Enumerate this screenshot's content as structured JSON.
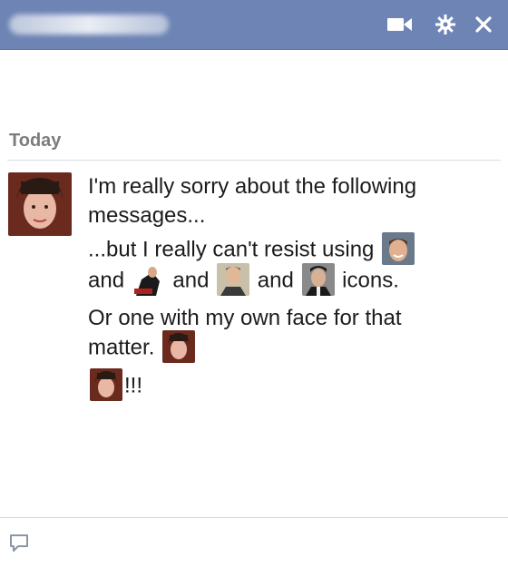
{
  "window": {
    "title_blurred": "",
    "icons": [
      "video-call-icon",
      "gear-icon",
      "close-icon"
    ]
  },
  "conversation": {
    "date_label": "Today",
    "messages": {
      "line1": "I'm really sorry about the following messages...",
      "line2_text": "...but I really can't resist using",
      "line3_and_1": "and",
      "line3_and_2": "and",
      "line3_and_3": "and",
      "line3_end": "icons.",
      "line4": "Or one with my own face for that",
      "line5": "matter.",
      "line6": "!!!"
    }
  },
  "footer": {
    "icon": "compose-icon"
  },
  "colors": {
    "titlebar": "#6d84b4",
    "date_text": "#7c7c7c",
    "message_text": "#1c1c1c"
  }
}
